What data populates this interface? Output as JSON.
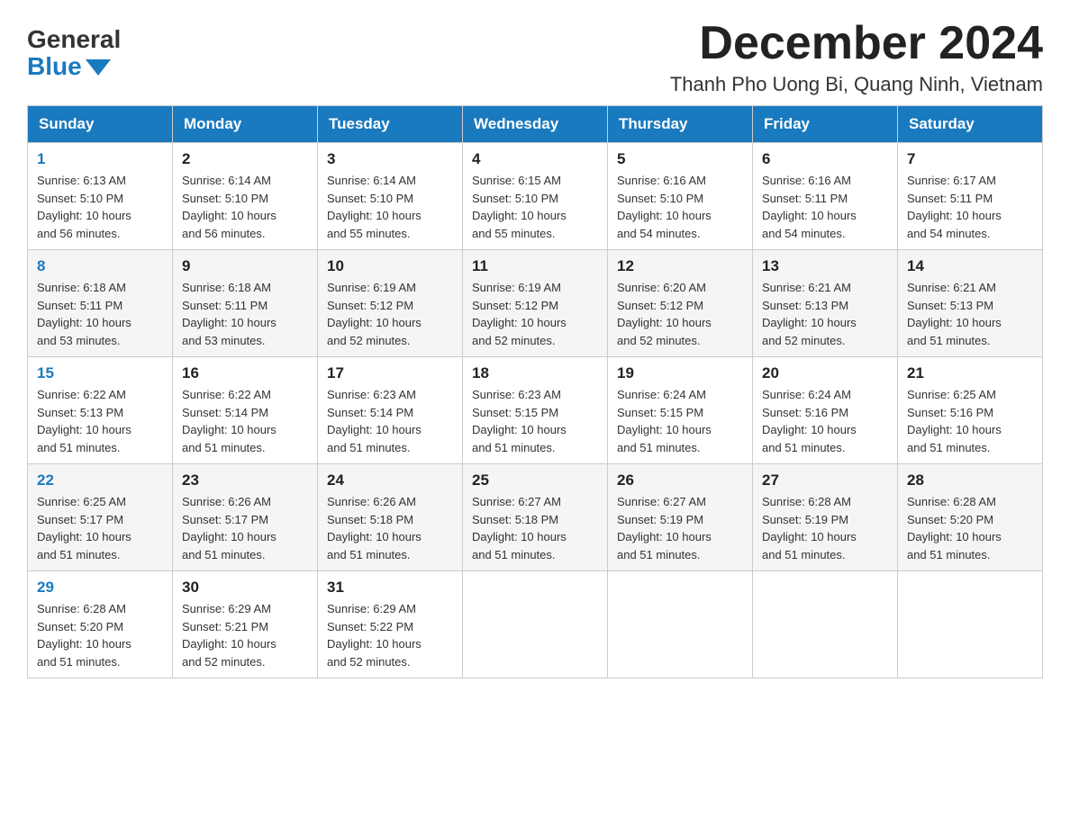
{
  "logo": {
    "general": "General",
    "blue": "Blue"
  },
  "title": {
    "month": "December 2024",
    "location": "Thanh Pho Uong Bi, Quang Ninh, Vietnam"
  },
  "weekdays": [
    "Sunday",
    "Monday",
    "Tuesday",
    "Wednesday",
    "Thursday",
    "Friday",
    "Saturday"
  ],
  "weeks": [
    [
      {
        "day": "1",
        "sunrise": "6:13 AM",
        "sunset": "5:10 PM",
        "daylight": "10 hours and 56 minutes."
      },
      {
        "day": "2",
        "sunrise": "6:14 AM",
        "sunset": "5:10 PM",
        "daylight": "10 hours and 56 minutes."
      },
      {
        "day": "3",
        "sunrise": "6:14 AM",
        "sunset": "5:10 PM",
        "daylight": "10 hours and 55 minutes."
      },
      {
        "day": "4",
        "sunrise": "6:15 AM",
        "sunset": "5:10 PM",
        "daylight": "10 hours and 55 minutes."
      },
      {
        "day": "5",
        "sunrise": "6:16 AM",
        "sunset": "5:10 PM",
        "daylight": "10 hours and 54 minutes."
      },
      {
        "day": "6",
        "sunrise": "6:16 AM",
        "sunset": "5:11 PM",
        "daylight": "10 hours and 54 minutes."
      },
      {
        "day": "7",
        "sunrise": "6:17 AM",
        "sunset": "5:11 PM",
        "daylight": "10 hours and 54 minutes."
      }
    ],
    [
      {
        "day": "8",
        "sunrise": "6:18 AM",
        "sunset": "5:11 PM",
        "daylight": "10 hours and 53 minutes."
      },
      {
        "day": "9",
        "sunrise": "6:18 AM",
        "sunset": "5:11 PM",
        "daylight": "10 hours and 53 minutes."
      },
      {
        "day": "10",
        "sunrise": "6:19 AM",
        "sunset": "5:12 PM",
        "daylight": "10 hours and 52 minutes."
      },
      {
        "day": "11",
        "sunrise": "6:19 AM",
        "sunset": "5:12 PM",
        "daylight": "10 hours and 52 minutes."
      },
      {
        "day": "12",
        "sunrise": "6:20 AM",
        "sunset": "5:12 PM",
        "daylight": "10 hours and 52 minutes."
      },
      {
        "day": "13",
        "sunrise": "6:21 AM",
        "sunset": "5:13 PM",
        "daylight": "10 hours and 52 minutes."
      },
      {
        "day": "14",
        "sunrise": "6:21 AM",
        "sunset": "5:13 PM",
        "daylight": "10 hours and 51 minutes."
      }
    ],
    [
      {
        "day": "15",
        "sunrise": "6:22 AM",
        "sunset": "5:13 PM",
        "daylight": "10 hours and 51 minutes."
      },
      {
        "day": "16",
        "sunrise": "6:22 AM",
        "sunset": "5:14 PM",
        "daylight": "10 hours and 51 minutes."
      },
      {
        "day": "17",
        "sunrise": "6:23 AM",
        "sunset": "5:14 PM",
        "daylight": "10 hours and 51 minutes."
      },
      {
        "day": "18",
        "sunrise": "6:23 AM",
        "sunset": "5:15 PM",
        "daylight": "10 hours and 51 minutes."
      },
      {
        "day": "19",
        "sunrise": "6:24 AM",
        "sunset": "5:15 PM",
        "daylight": "10 hours and 51 minutes."
      },
      {
        "day": "20",
        "sunrise": "6:24 AM",
        "sunset": "5:16 PM",
        "daylight": "10 hours and 51 minutes."
      },
      {
        "day": "21",
        "sunrise": "6:25 AM",
        "sunset": "5:16 PM",
        "daylight": "10 hours and 51 minutes."
      }
    ],
    [
      {
        "day": "22",
        "sunrise": "6:25 AM",
        "sunset": "5:17 PM",
        "daylight": "10 hours and 51 minutes."
      },
      {
        "day": "23",
        "sunrise": "6:26 AM",
        "sunset": "5:17 PM",
        "daylight": "10 hours and 51 minutes."
      },
      {
        "day": "24",
        "sunrise": "6:26 AM",
        "sunset": "5:18 PM",
        "daylight": "10 hours and 51 minutes."
      },
      {
        "day": "25",
        "sunrise": "6:27 AM",
        "sunset": "5:18 PM",
        "daylight": "10 hours and 51 minutes."
      },
      {
        "day": "26",
        "sunrise": "6:27 AM",
        "sunset": "5:19 PM",
        "daylight": "10 hours and 51 minutes."
      },
      {
        "day": "27",
        "sunrise": "6:28 AM",
        "sunset": "5:19 PM",
        "daylight": "10 hours and 51 minutes."
      },
      {
        "day": "28",
        "sunrise": "6:28 AM",
        "sunset": "5:20 PM",
        "daylight": "10 hours and 51 minutes."
      }
    ],
    [
      {
        "day": "29",
        "sunrise": "6:28 AM",
        "sunset": "5:20 PM",
        "daylight": "10 hours and 51 minutes."
      },
      {
        "day": "30",
        "sunrise": "6:29 AM",
        "sunset": "5:21 PM",
        "daylight": "10 hours and 52 minutes."
      },
      {
        "day": "31",
        "sunrise": "6:29 AM",
        "sunset": "5:22 PM",
        "daylight": "10 hours and 52 minutes."
      },
      null,
      null,
      null,
      null
    ]
  ],
  "labels": {
    "sunrise": "Sunrise:",
    "sunset": "Sunset:",
    "daylight": "Daylight:"
  }
}
